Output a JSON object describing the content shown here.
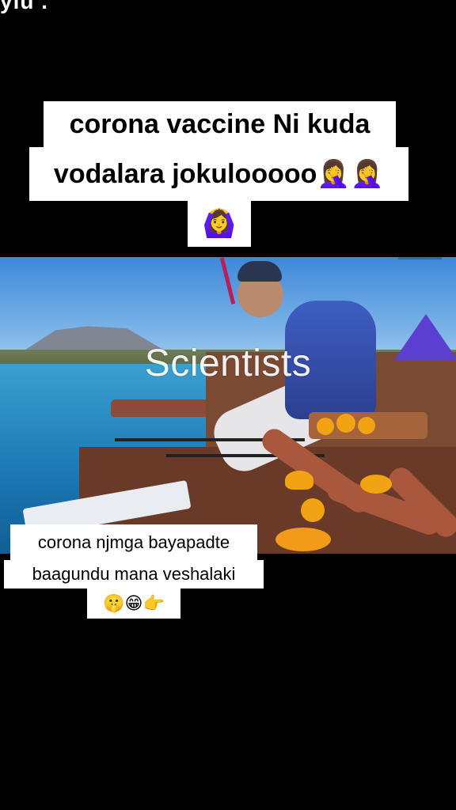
{
  "top_fragment": "ylu .",
  "caption_top": {
    "line1": "corona vaccine Ni kuda",
    "line2": "vodalara jokulooooo",
    "line2_emojis": "🤦‍♀️🤦‍♀️",
    "line3_emojis": "🙆‍♀️"
  },
  "video": {
    "watermark_text": "Scientists",
    "description": ""
  },
  "caption_bottom": {
    "line1": "corona njmga bayapadte",
    "line2": "baagundu mana veshalaki",
    "line3_emojis": "🤫😁👉"
  },
  "colors": {
    "background": "#000000",
    "caption_bg": "#ffffff",
    "caption_text": "#000000"
  }
}
